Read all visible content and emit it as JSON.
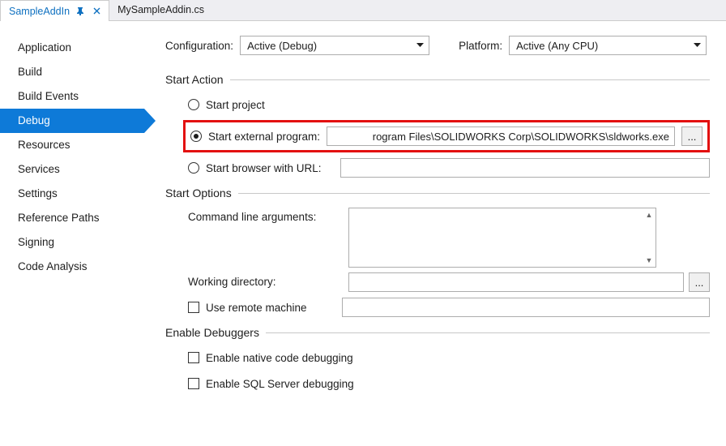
{
  "tabs": {
    "active": "SampleAddIn",
    "inactive": "MySampleAddin.cs"
  },
  "sidebar": {
    "items": [
      "Application",
      "Build",
      "Build Events",
      "Debug",
      "Resources",
      "Services",
      "Settings",
      "Reference Paths",
      "Signing",
      "Code Analysis"
    ],
    "selected": "Debug"
  },
  "top": {
    "configuration_label": "Configuration:",
    "configuration_value": "Active (Debug)",
    "platform_label": "Platform:",
    "platform_value": "Active (Any CPU)"
  },
  "start_action": {
    "header": "Start Action",
    "opt_start_project": "Start project",
    "opt_external_program": "Start external program:",
    "external_program_value": "rogram Files\\SOLIDWORKS Corp\\SOLIDWORKS\\sldworks.exe",
    "opt_browser": "Start browser with URL:",
    "browse_btn": "..."
  },
  "start_options": {
    "header": "Start Options",
    "cmdline_label": "Command line arguments:",
    "workdir_label": "Working directory:",
    "browse_btn": "...",
    "remote_label": "Use remote machine"
  },
  "enable_debuggers": {
    "header": "Enable Debuggers",
    "native_label": "Enable native code debugging",
    "sql_label": "Enable SQL Server debugging"
  }
}
